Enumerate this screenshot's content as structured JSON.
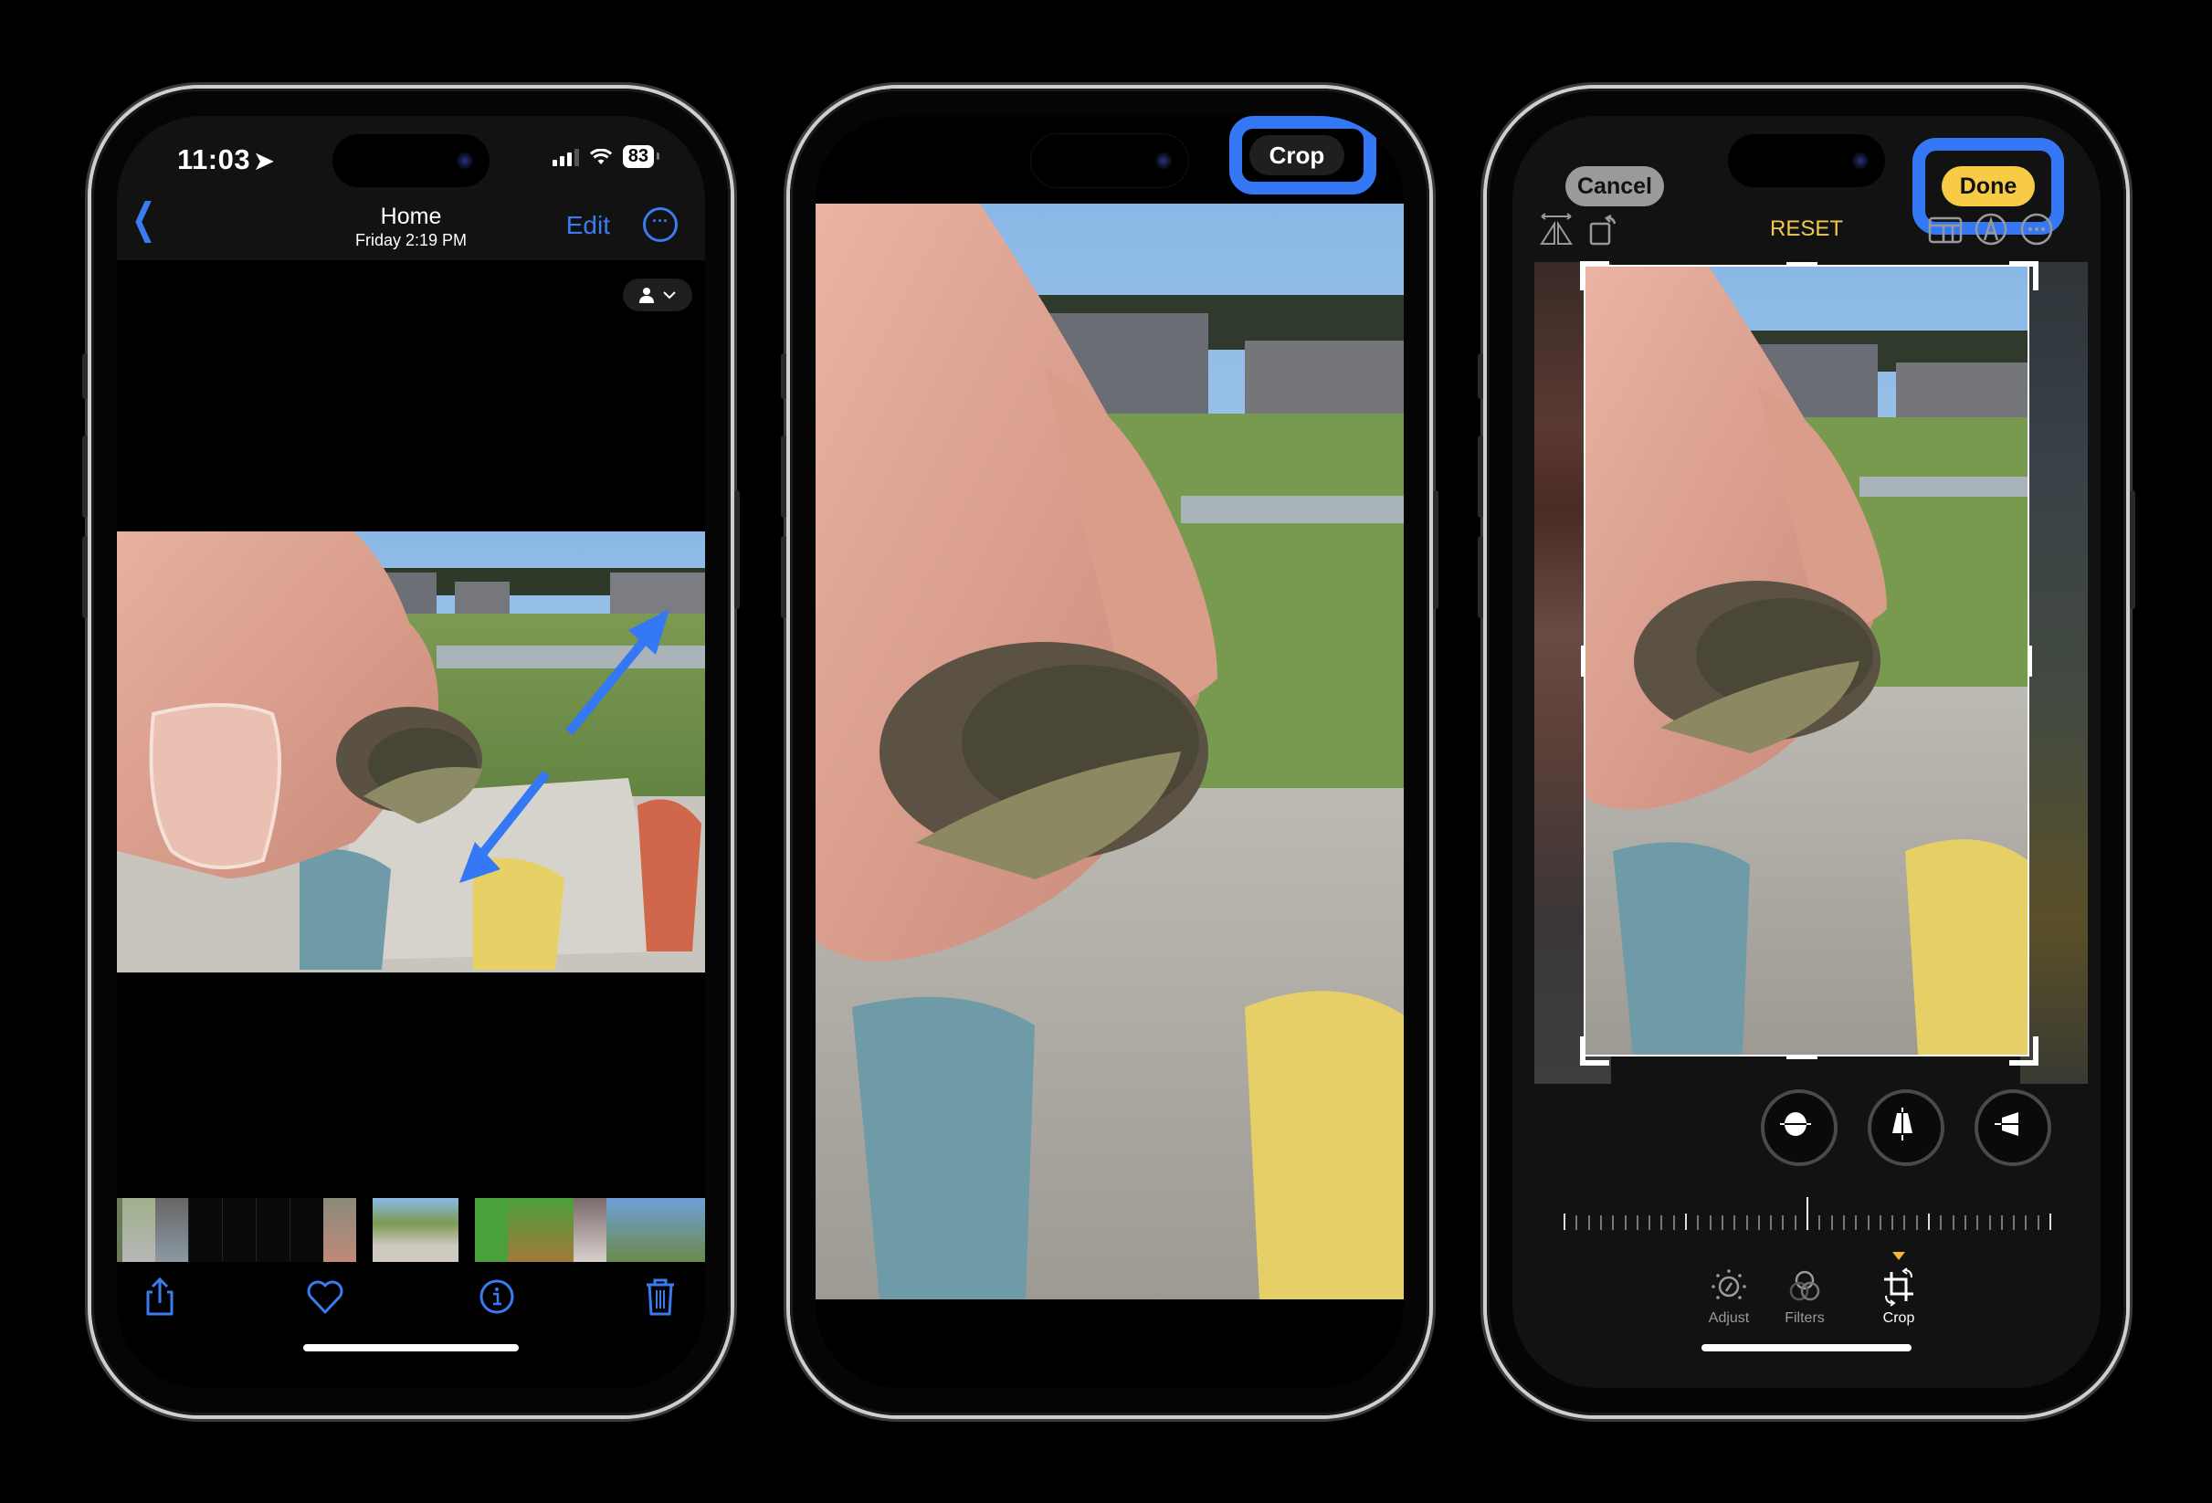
{
  "phone1": {
    "status": {
      "time": "11:03",
      "battery": "83"
    },
    "nav": {
      "title": "Home",
      "subtitle": "Friday  2:19 PM",
      "edit_label": "Edit"
    },
    "toolbar": {
      "icons": [
        "share-icon",
        "heart-icon",
        "info-icon",
        "trash-icon"
      ]
    },
    "annotation": {
      "arrow_color": "#3478f6"
    }
  },
  "phone2": {
    "crop_label": "Crop",
    "highlight_color": "#3478f6"
  },
  "phone3": {
    "cancel_label": "Cancel",
    "done_label": "Done",
    "reset_label": "RESET",
    "accent_color": "#f2c94c",
    "highlight_color": "#3478f6",
    "modes": [
      {
        "label": "Adjust",
        "active": false
      },
      {
        "label": "Filters",
        "active": false
      },
      {
        "label": "Crop",
        "active": true
      }
    ],
    "perspective_tools": [
      "straighten",
      "vertical",
      "horizontal"
    ],
    "top_tools": [
      "flip-icon",
      "rotate-icon",
      "aspect-ratio-icon",
      "markup-icon",
      "more-icon"
    ]
  }
}
